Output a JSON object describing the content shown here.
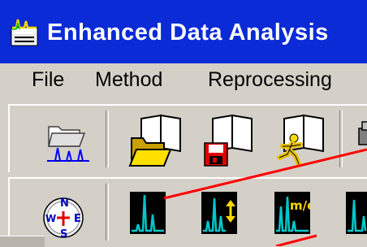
{
  "window": {
    "title": "Enhanced Data Analysis"
  },
  "menu": {
    "items": [
      {
        "label": "File"
      },
      {
        "label": "Method"
      },
      {
        "label": "Reprocessing"
      }
    ]
  },
  "toolbar1": {
    "buttons": [
      {
        "icon": "open-data-folder-icon"
      },
      {
        "icon": "open-method-folder-icon"
      },
      {
        "icon": "save-method-icon"
      },
      {
        "icon": "run-method-icon"
      },
      {
        "icon": "partial-toolbar-icon"
      }
    ]
  },
  "toolbar2": {
    "buttons": [
      {
        "icon": "navigator-compass-icon"
      },
      {
        "icon": "chromatogram-icon"
      },
      {
        "icon": "chromatogram-scale-icon"
      },
      {
        "icon": "mass-spectrum-icon",
        "label": "m/e"
      },
      {
        "icon": "partial-chromatogram-icon"
      }
    ]
  },
  "colors": {
    "titlebar": "#0b2bd6",
    "toolbar_bg": "#d4d0c8",
    "callout_line": "#ff0000",
    "signal": "#00c8c8"
  }
}
